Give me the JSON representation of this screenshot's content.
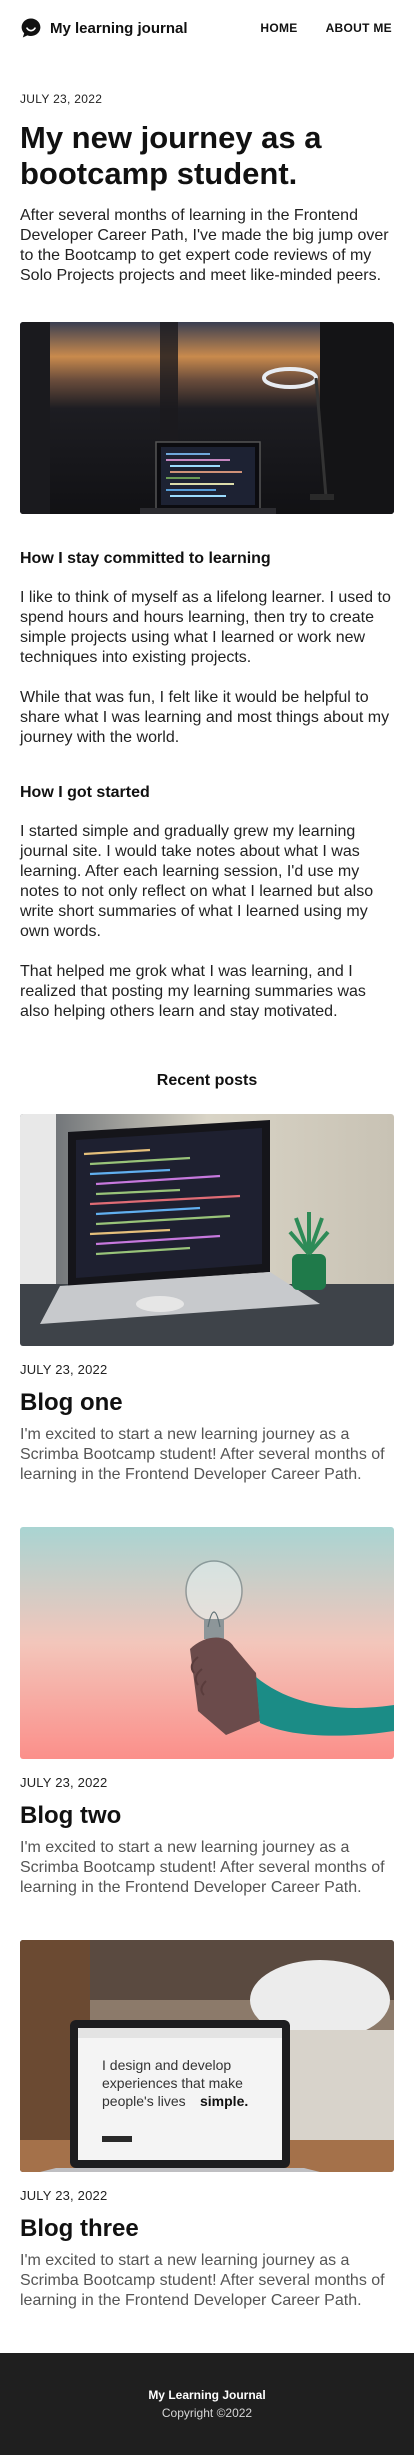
{
  "nav": {
    "brand": "My learning journal",
    "links": [
      {
        "label": "HOME"
      },
      {
        "label": "ABOUT ME"
      }
    ]
  },
  "article": {
    "date": "JULY 23, 2022",
    "title": "My new journey as a bootcamp student.",
    "lede": "After several months of learning in the Frontend Developer Career Path, I've made the big jump over to the Bootcamp to get expert code reviews of my Solo Projects projects and meet like-minded peers.",
    "hero_image": "laptop-on-desk-at-dusk-photo",
    "sections": [
      {
        "heading": "How I stay committed to learning",
        "paragraphs": [
          "I like to think of myself as a lifelong learner. I used to spend hours and hours learning, then try to create simple projects using what I learned or work new techniques into existing projects.",
          "While that was fun, I felt like it would be helpful to share what I was learning and most things about my journey with the world."
        ]
      },
      {
        "heading": "How I got started",
        "paragraphs": [
          "I started simple and gradually grew my learning journal site. I would take notes about what I was learning. After each learning session, I'd use my notes to not only reflect on what I learned but also write short summaries of what I learned using my own words.",
          "That helped me grok what I was learning, and I realized that posting my learning summaries was also helping others learn and stay motivated."
        ]
      }
    ]
  },
  "recent": {
    "heading": "Recent posts",
    "posts": [
      {
        "image": "laptop-with-code-and-plant-photo",
        "date": "JULY 23, 2022",
        "title": "Blog one",
        "excerpt": "I'm excited to start a new learning journey as a Scrimba Bootcamp student! After several months of learning in the Frontend Developer Career Path."
      },
      {
        "image": "hand-holding-lightbulb-photo",
        "date": "JULY 23, 2022",
        "title": "Blog two",
        "excerpt": "I'm excited to start a new learning journey as a Scrimba Bootcamp student! After several months of learning in the Frontend Developer Career Path."
      },
      {
        "image": "laptop-showing-design-text-photo",
        "image_text": [
          "I design and develop",
          "experiences that make",
          "people's lives",
          "simple."
        ],
        "date": "JULY 23, 2022",
        "title": "Blog three",
        "excerpt": "I'm excited to start a new learning journey as a Scrimba Bootcamp student! After several months of learning in the Frontend Developer Career Path."
      }
    ]
  },
  "footer": {
    "name": "My Learning Journal",
    "copyright": "Copyright ©2022"
  },
  "colors": {
    "footer_bg": "#1f1f1f",
    "text": "#111111",
    "muted": "#555555"
  }
}
